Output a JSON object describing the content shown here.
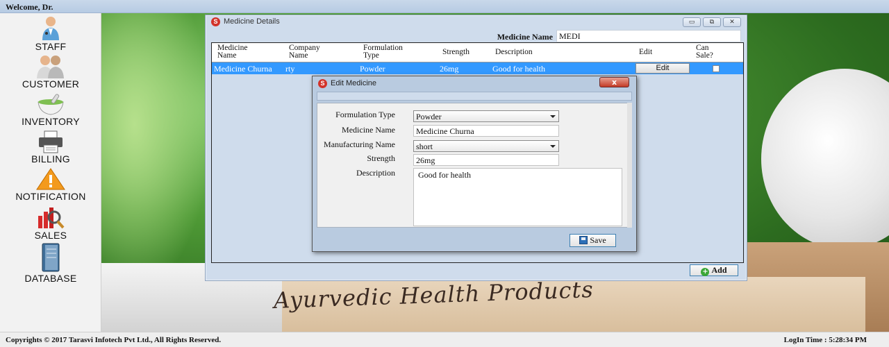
{
  "topbar": {
    "welcome": "Welcome, Dr."
  },
  "sidebar": {
    "items": [
      {
        "label": "STAFF",
        "icon": "doctor-icon"
      },
      {
        "label": "CUSTOMER",
        "icon": "customers-icon"
      },
      {
        "label": "INVENTORY",
        "icon": "mortar-icon"
      },
      {
        "label": "BILLING",
        "icon": "printer-icon"
      },
      {
        "label": "NOTIFICATION",
        "icon": "warning-icon"
      },
      {
        "label": "SALES",
        "icon": "sales-icon"
      },
      {
        "label": "DATABASE",
        "icon": "database-icon"
      }
    ]
  },
  "background": {
    "board_text": "Ayurvedic Health Products"
  },
  "medicine_window": {
    "title": "Medicine Details",
    "app_icon_letter": "S",
    "controls": {
      "minimize": "▭",
      "restore": "⧉",
      "close": "✕"
    },
    "search": {
      "label": "Medicine Name",
      "value": "MEDI"
    },
    "table": {
      "columns": [
        "Medicine Name",
        "Company Name",
        "Formulation Type",
        "Strength",
        "Description",
        "Edit",
        "Can Sale?"
      ],
      "rows": [
        {
          "medicine_name": "Medicine Churna",
          "company_name": "rty",
          "formulation_type": "Powder",
          "strength": "26mg",
          "description": "Good for health",
          "edit_label": "Edit",
          "can_sale": false
        }
      ]
    },
    "add_label": "Add"
  },
  "edit_dialog": {
    "title": "Edit Medicine",
    "close_glyph": "x",
    "fields": {
      "formulation_type": {
        "label": "Formulation  Type",
        "value": "Powder"
      },
      "medicine_name": {
        "label": "Medicine Name",
        "value": "Medicine Churna"
      },
      "manufacturing_name": {
        "label": "Manufacturing Name",
        "value": "short"
      },
      "strength": {
        "label": "Strength",
        "value": "26mg"
      },
      "description": {
        "label": "Description",
        "value": "Good for health"
      }
    },
    "save_label": "Save"
  },
  "footer": {
    "copyright": "Copyrights © 2017 Tarasvi Infotech Pvt Ltd., All Rights Reserved.",
    "login_time": "LogIn Time : 5:28:34 PM"
  },
  "colors": {
    "selection": "#3399ff",
    "topbar": "#c9d8ea",
    "window": "#cfdcec"
  }
}
